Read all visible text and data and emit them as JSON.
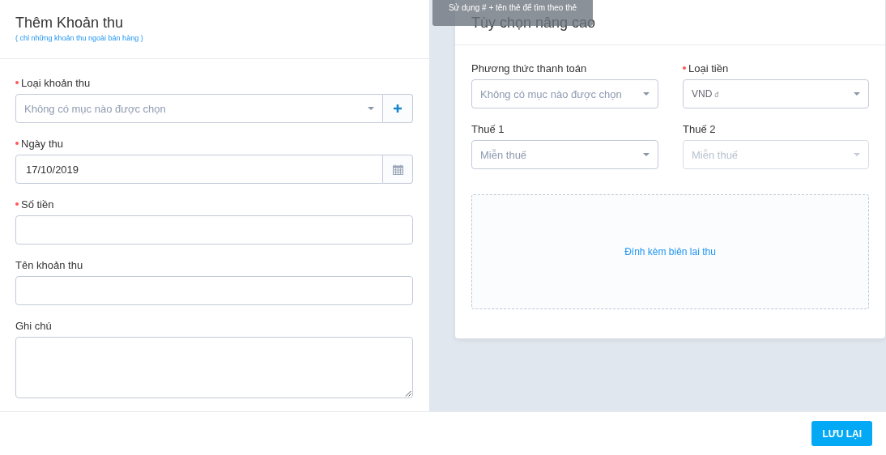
{
  "form": {
    "title": "Thêm Khoản thu",
    "subtitle": "( chỉ những khoản thu ngoài bán hàng )",
    "fields": [
      {
        "kind": "select",
        "label": "Loại khoản thu",
        "required": true,
        "placeholder": "Không có mục nào được chọn",
        "add_button": true
      },
      {
        "kind": "date",
        "label": "Ngày thu",
        "required": true,
        "value": "17/10/2019"
      },
      {
        "kind": "input",
        "label": "Số tiền",
        "required": true
      },
      {
        "kind": "input",
        "label": "Tên khoản thu",
        "required": false
      },
      {
        "kind": "textarea",
        "label": "Ghi chú",
        "required": false
      }
    ]
  },
  "advanced": {
    "title": "Tùy chọn nâng cao",
    "fields": [
      {
        "label": "Phương thức thanh toán",
        "required": false,
        "placeholder": "Không có mục nào được chọn",
        "disabled": false
      },
      {
        "label": "Loại tiền",
        "required": true,
        "value": "VND",
        "symbol": "đ",
        "disabled": false
      },
      {
        "label": "Thuế 1",
        "required": false,
        "placeholder": "Miễn thuế",
        "disabled": false
      },
      {
        "label": "Thuế 2",
        "required": false,
        "placeholder": "Miễn thuế",
        "disabled": true
      }
    ],
    "attachment": "Đính kèm biên lai thu"
  },
  "tooltip": "Sử dụng # + tên thẻ để tìm theo thẻ",
  "save_button": "LƯU LẠI"
}
